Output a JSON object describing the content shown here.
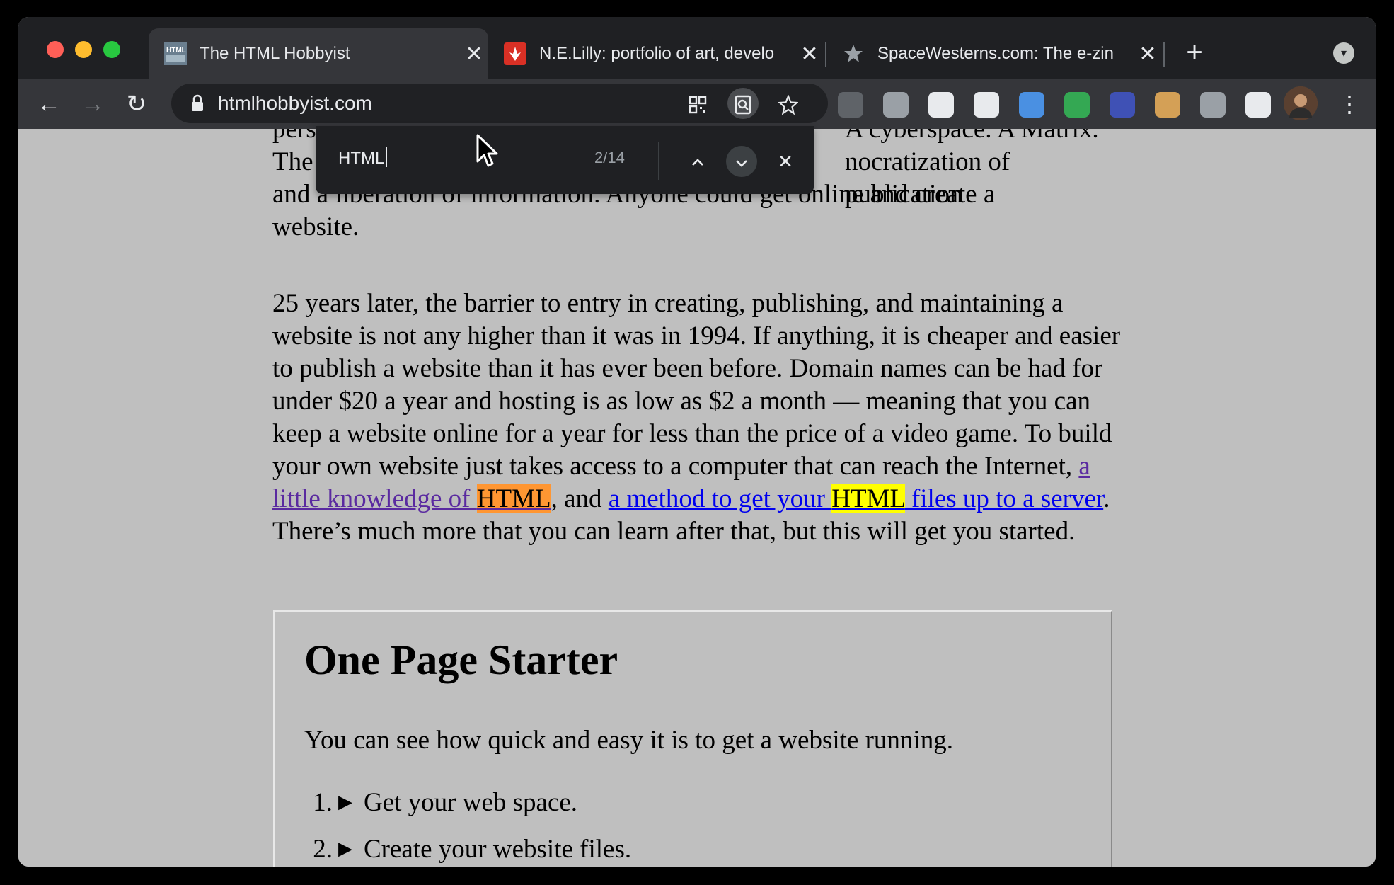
{
  "browser": {
    "tabs": [
      {
        "title": "The HTML Hobbyist",
        "close": "✕",
        "favicon_color": "#7a8a9a"
      },
      {
        "title": "N.E.Lilly: portfolio of art, develo",
        "close": "✕",
        "favicon_color": "#d93025"
      },
      {
        "title": "SpaceWesterns.com: The e-zin",
        "close": "✕",
        "favicon_color": "#9aa0a6"
      }
    ],
    "new_tab": "+",
    "tab_menu": "▾",
    "nav": {
      "back": "←",
      "forward": "→",
      "reload": "↻"
    },
    "url": "htmlhobbyist.com",
    "omnibox_icons": [
      "qr-code-icon",
      "find-in-page-icon",
      "bookmark-star-icon"
    ],
    "extensions": [
      {
        "name": "extension-1-icon",
        "color": "#5f6368"
      },
      {
        "name": "target-extension-icon",
        "color": "#9aa0a6"
      },
      {
        "name": "react-devtools-icon",
        "color": "#e8eaed"
      },
      {
        "name": "extension-4-icon",
        "color": "#e8eaed"
      },
      {
        "name": "screen-extension-icon",
        "color": "#4a90e2"
      },
      {
        "name": "chart-extension-icon",
        "color": "#34a853"
      },
      {
        "name": "extension-7-icon",
        "color": "#3f51b5"
      },
      {
        "name": "cookie-extension-icon",
        "color": "#d4a056"
      },
      {
        "name": "camera-extension-icon",
        "color": "#9aa0a6"
      },
      {
        "name": "puzzle-extensions-icon",
        "color": "#e8eaed"
      }
    ],
    "menu": "⋮"
  },
  "find_bar": {
    "query": "HTML",
    "count": "2/14",
    "prev": "⌃",
    "next": "⌄",
    "close": "✕"
  },
  "article": {
    "para1": {
      "line1": "pers",
      "line1_tail": "A cyberspace. A Matrix.",
      "line2": "The",
      "line2_tail": "nocratization of publication",
      "rest": "and a liberation of information. Anyone could get online and create a website."
    },
    "para2": {
      "text": "25 years later, the barrier to entry in creating, publishing, and maintaining a website is not any higher than it was in 1994. If anything, it is cheaper and easier to publish a website than it has ever been before. Domain names can be had for under $20 a year and hosting is as low as $2 a month — meaning that you can keep a website online for a year for less than the price of a video game. To build your own website just takes access to a computer that can reach the Internet, ",
      "link1_pre": "a little knowledge of ",
      "link1_match": "HTML",
      "between": ", and ",
      "link2_pre": "a method to get your ",
      "link2_match": "HTML",
      "link2_post": " files up to a server",
      "tail": ". There’s much more that you can learn after that, but this will get you started."
    }
  },
  "starter": {
    "title": "One Page Starter",
    "intro": "You can see how quick and easy it is to get a website running.",
    "items": [
      {
        "num": "1.",
        "marker": "▶",
        "label": "Get your web space."
      },
      {
        "num": "2.",
        "marker": "▶",
        "label": "Create your website files."
      }
    ]
  }
}
